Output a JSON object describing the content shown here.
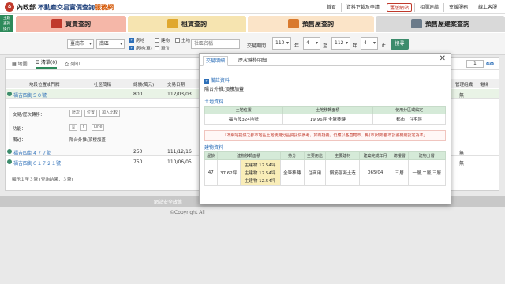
{
  "site": {
    "org": "內政部",
    "title_main": "不動產交易實價查詢",
    "title_highlight": "服務網",
    "top_links": [
      "首頁",
      "資料下載及申請",
      "舊版網站",
      "相關連結",
      "支援服務",
      "線上客服"
    ]
  },
  "side_badge": "主題\n查詢\n操作",
  "main_tabs": [
    "買賣查詢",
    "租賃查詢",
    "預售屋查詢",
    "預售屋建案查詢"
  ],
  "search": {
    "city": "臺南市",
    "district": "南區",
    "types": [
      {
        "label": "房地",
        "checked": true
      },
      {
        "label": "房地(車)",
        "checked": true
      },
      {
        "label": "建物",
        "checked": false
      },
      {
        "label": "車位",
        "checked": false
      },
      {
        "label": "土地",
        "checked": false
      }
    ],
    "community_placeholder": "社區名稱",
    "period_label": "交易期間：",
    "from_year": "110",
    "from_month": "4",
    "to_year": "112",
    "to_month": "4",
    "unit_year": "年",
    "unit_month": "月",
    "to_label": "至",
    "to_suffix": "止",
    "submit": "搜尋"
  },
  "results": {
    "tabs": [
      "地圖",
      "清單(0)",
      "列印"
    ],
    "page": "1",
    "go": "GO",
    "headers": [
      "地段位置或門牌",
      "社區簡稱",
      "總價(萬元)",
      "交易日期",
      "管理組織",
      "電梯"
    ],
    "rows": [
      {
        "addr": "福吉四街５０號",
        "price": "800",
        "date": "112/03/03",
        "mgmt": "無"
      },
      {
        "addr": "福吉四街４７７號",
        "price": "250",
        "date": "111/12/16",
        "mgmt": "無"
      },
      {
        "addr": "福吉四街６１７２１號",
        "price": "750",
        "date": "110/06/05",
        "mgmt": "無"
      }
    ],
    "detail": {
      "history_label": "交易/歷次轉移：",
      "history_buttons": [
        "歷次",
        "位置",
        "加入比較"
      ],
      "function_label": "功能：",
      "note_label": "備註：",
      "note_value": "陽台外推;頂樓加蓋"
    },
    "summary": "顯示１至３筆 (查詢結果：３筆)"
  },
  "footer": {
    "links": "網站安全政策",
    "copyright": "©Copyright All"
  },
  "modal": {
    "tabs": [
      "交易明細",
      "歷次轉移明細"
    ],
    "remark_title": "備註資料",
    "remark_value": "陽台外推;頂樓加蓋",
    "land_title": "土地資料",
    "land_headers": [
      "土地位置",
      "土地移轉面積",
      "使用分區或編定"
    ],
    "land_row": [
      "福吉段324地號",
      "19.96坪 全筆移轉",
      "都市：住宅區"
    ],
    "warning": "「本網站提供之都市地區土地使用分區資訊供參考，如有疑義，仍應以各直轄市、縣(市)政府都市計畫機關認定為準」",
    "building_title": "建物資料",
    "building_headers": [
      "屋齡",
      "建物移轉面積",
      "持分",
      "主要用途",
      "主要建材",
      "建築完成年月",
      "總樓層",
      "建物分層"
    ],
    "building_row": {
      "age": "47",
      "area": "37.62坪",
      "sub": [
        {
          "label": "主建物",
          "value": "12.54坪"
        },
        {
          "label": "主建物",
          "value": "12.54坪"
        },
        {
          "label": "主建物",
          "value": "12.54坪"
        }
      ],
      "share": "全筆移轉",
      "use": "住商用",
      "material": "鋼筋混凝土造",
      "completed": "065/04",
      "floors": "三層",
      "layers": "一層,二層,三層"
    }
  }
}
